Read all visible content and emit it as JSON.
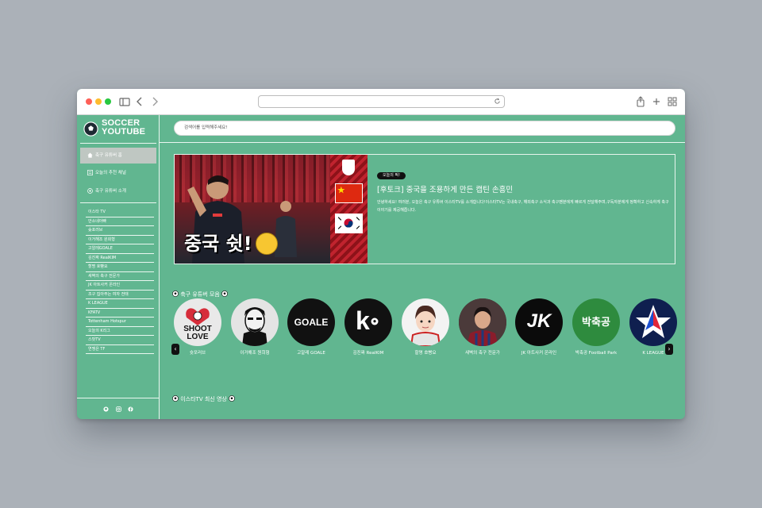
{
  "browser": {
    "url": ""
  },
  "logo": {
    "line1": "SOCCER",
    "line2": "YOUTUBE"
  },
  "nav": [
    {
      "label": "축구 유튜버 홈",
      "icon": "home-icon",
      "active": true
    },
    {
      "label": "오늘의 추천 채널",
      "icon": "list-icon",
      "active": false
    },
    {
      "label": "축구 유튜버 소개",
      "icon": "plus-circle-icon",
      "active": false
    }
  ],
  "channel_list": [
    "이스타 TV",
    "안소네아빠",
    "슛포러브",
    "이거해조 원희형",
    "고알레GOALE",
    "김진짜 RealKIM",
    "할명 호빵요",
    "새벽의 축구 전문가",
    "JK 아트사커 온라인",
    "조구 집아주는 여자 전태",
    "K LEAGUE",
    "KFATV",
    "Tottenham Hotspur",
    "오늘의 K리그",
    "스팟TV",
    "연맹은 TF"
  ],
  "search": {
    "placeholder": "검색어를 입력해주세요!"
  },
  "featured": {
    "badge": "오늘의 픽!",
    "title": "[후토크] 중국을 조용하게 만든 캡틴 손흥민",
    "description": "안녕하세요! 여러분, 오늘은 축구 유튜버 이스타TV를 소개합니다!이스타TV는 국내축구, 해외축구 소식과 축구팬분에게 빠르게 전달해주며,구독자분에게 정확하고 신속하게 축구이야기를 제공해줍니다.",
    "thumb_caption": "중국 쉿!"
  },
  "sections": {
    "channels_title": "축구 유튜버 모음",
    "latest_title": "이스타TV 최신 영상"
  },
  "channels": [
    {
      "name": "슛포러브",
      "avatar_text": "SHOOT LOVE",
      "bg": "#e9e9e9",
      "fg": "#111111"
    },
    {
      "name": "이거해조 원희형",
      "avatar_text": "",
      "bg": "#e4e4e4",
      "fg": "#111111"
    },
    {
      "name": "고알레 GOALE",
      "avatar_text": "GOALE",
      "bg": "#111111",
      "fg": "#ffffff"
    },
    {
      "name": "김진짜 RealKIM",
      "avatar_text": "k",
      "bg": "#111111",
      "fg": "#ffffff"
    },
    {
      "name": "할명 호빵요",
      "avatar_text": "",
      "bg": "#f3f3f3",
      "fg": "#111111"
    },
    {
      "name": "새벽의 축구 전문가",
      "avatar_text": "",
      "bg": "#3b2a2a",
      "fg": "#ffffff"
    },
    {
      "name": "JK 아트사커 온라인",
      "avatar_text": "JK",
      "bg": "#0b0b0b",
      "fg": "#ffffff"
    },
    {
      "name": "박축공 Football Park",
      "avatar_text": "박축공",
      "bg": "#2e8b3e",
      "fg": "#ffffff"
    },
    {
      "name": "K LEAGUE",
      "avatar_text": "",
      "bg": "#0f1f4f",
      "fg": "#ffffff"
    }
  ],
  "colors": {
    "background": "#61b690",
    "accent": "#ffffff",
    "dark": "#111111"
  }
}
